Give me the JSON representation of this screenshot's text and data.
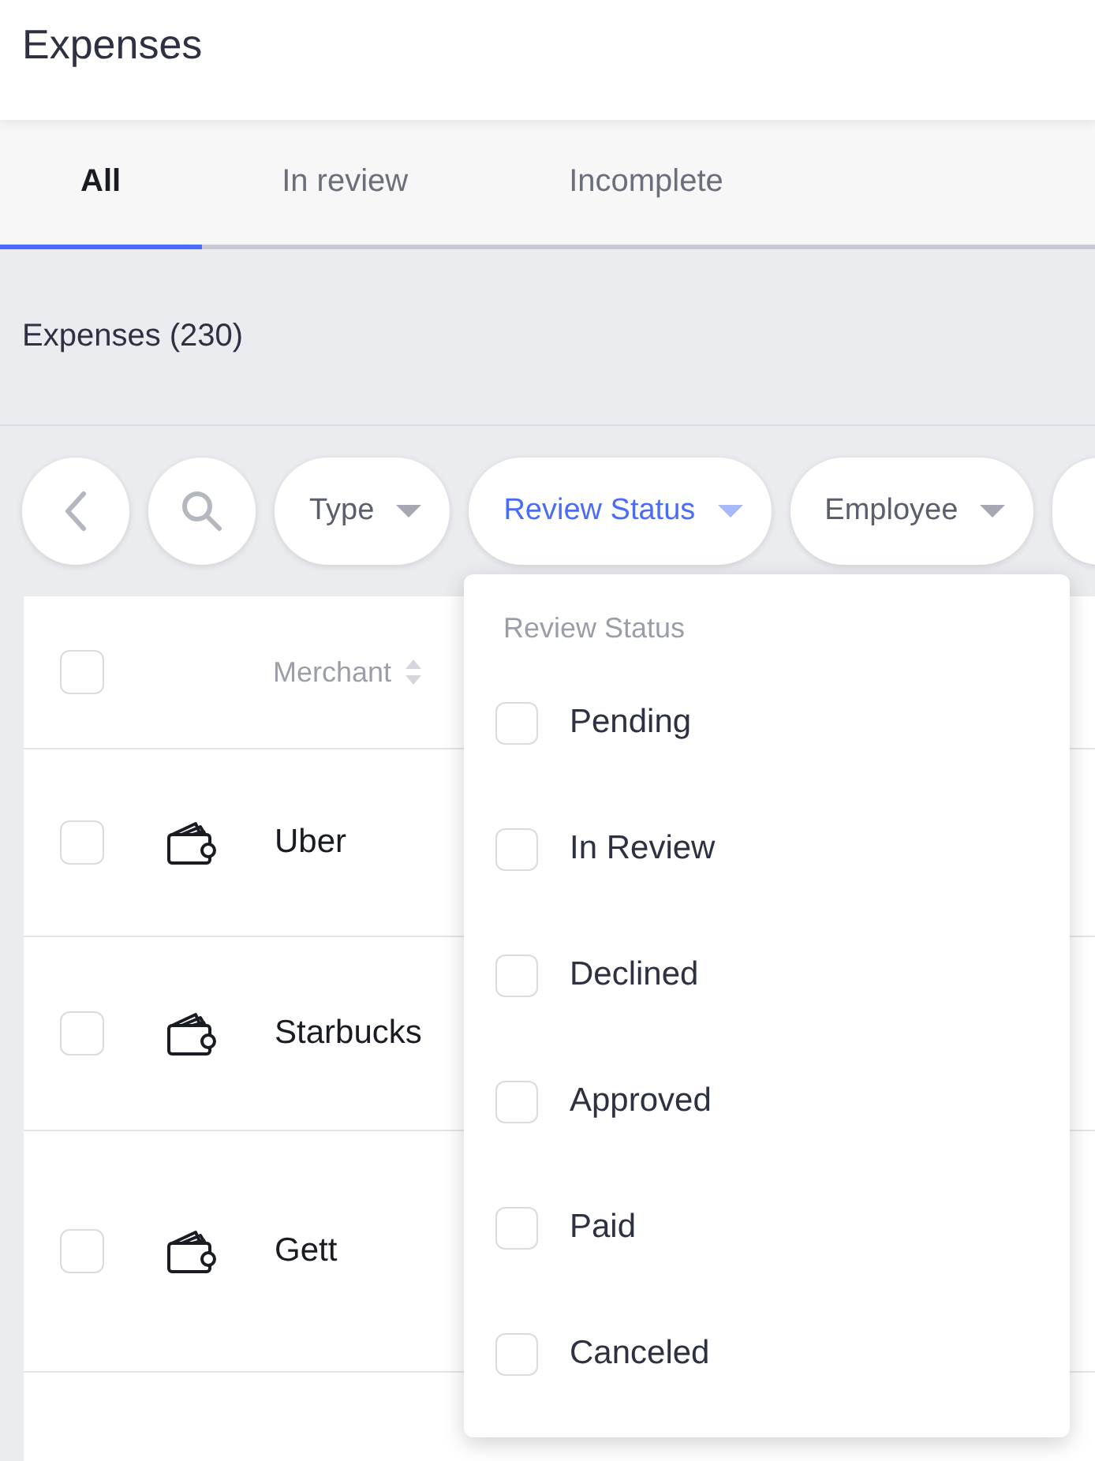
{
  "page": {
    "title": "Expenses"
  },
  "tabs": [
    {
      "label": "All",
      "selected": true
    },
    {
      "label": "In review",
      "selected": false
    },
    {
      "label": "Incomplete",
      "selected": false
    }
  ],
  "section": {
    "title": "Expenses (230)"
  },
  "filters": [
    {
      "kind": "back"
    },
    {
      "kind": "search"
    },
    {
      "kind": "dropdown",
      "label": "Type",
      "selected": false
    },
    {
      "kind": "dropdown",
      "label": "Review Status",
      "selected": true
    },
    {
      "kind": "dropdown",
      "label": "Employee",
      "selected": false
    },
    {
      "kind": "cut"
    }
  ],
  "table": {
    "select_all": {
      "checked": false
    },
    "columns": [
      "Merchant"
    ],
    "rows": [
      {
        "merchant": "Uber",
        "checked": false
      },
      {
        "merchant": "Starbucks",
        "checked": false
      },
      {
        "merchant": "Gett",
        "checked": false
      }
    ]
  },
  "dropdown": {
    "title": "Review Status",
    "options": [
      {
        "label": "Pending",
        "checked": false
      },
      {
        "label": "In Review",
        "checked": false
      },
      {
        "label": "Declined",
        "checked": false
      },
      {
        "label": "Approved",
        "checked": false
      },
      {
        "label": "Paid",
        "checked": false
      },
      {
        "label": "Canceled",
        "checked": false
      }
    ]
  }
}
